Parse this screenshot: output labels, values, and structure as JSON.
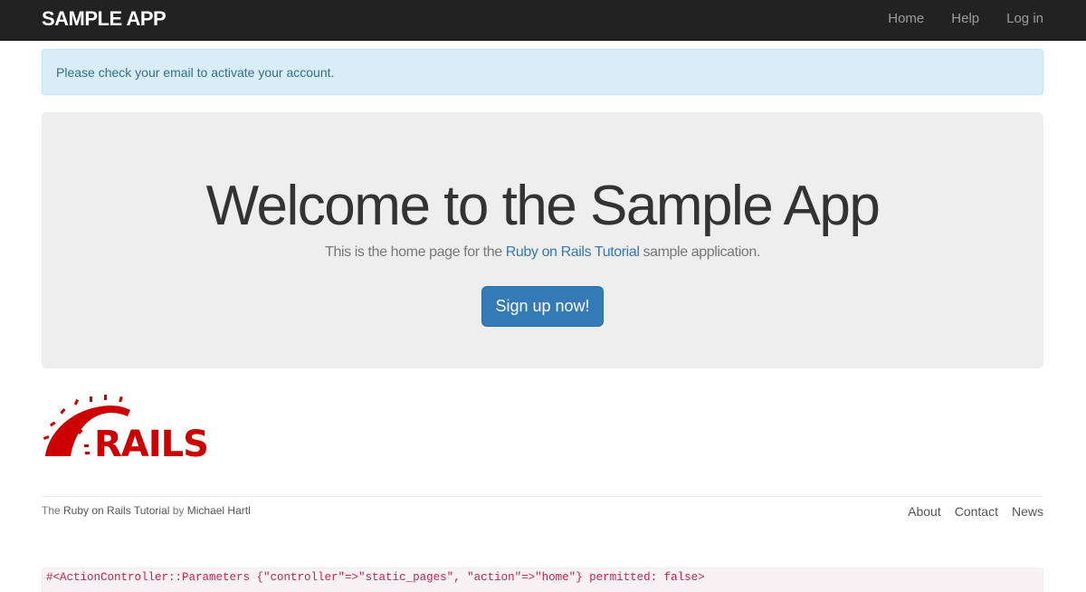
{
  "navbar": {
    "brand": "SAMPLE APP",
    "links": [
      "Home",
      "Help",
      "Log in"
    ]
  },
  "alert": {
    "message": "Please check your email to activate your account."
  },
  "jumbotron": {
    "title": "Welcome to the Sample App",
    "sub_prefix": "This is the home page for the ",
    "sub_link": "Ruby on Rails Tutorial",
    "sub_suffix": " sample application.",
    "button_label": "Sign up now!"
  },
  "logo": {
    "text": "RAILS",
    "color": "#cc0000",
    "icon": "rails-logo"
  },
  "footer": {
    "credit_prefix": "The ",
    "credit_link": "Ruby on Rails Tutorial",
    "credit_mid": " by ",
    "credit_author": "Michael Hartl",
    "links": [
      "About",
      "Contact",
      "News"
    ]
  },
  "debug": {
    "text": "#<ActionController::Parameters {\"controller\"=>\"static_pages\", \"action\"=>\"home\"} permitted: false>"
  }
}
